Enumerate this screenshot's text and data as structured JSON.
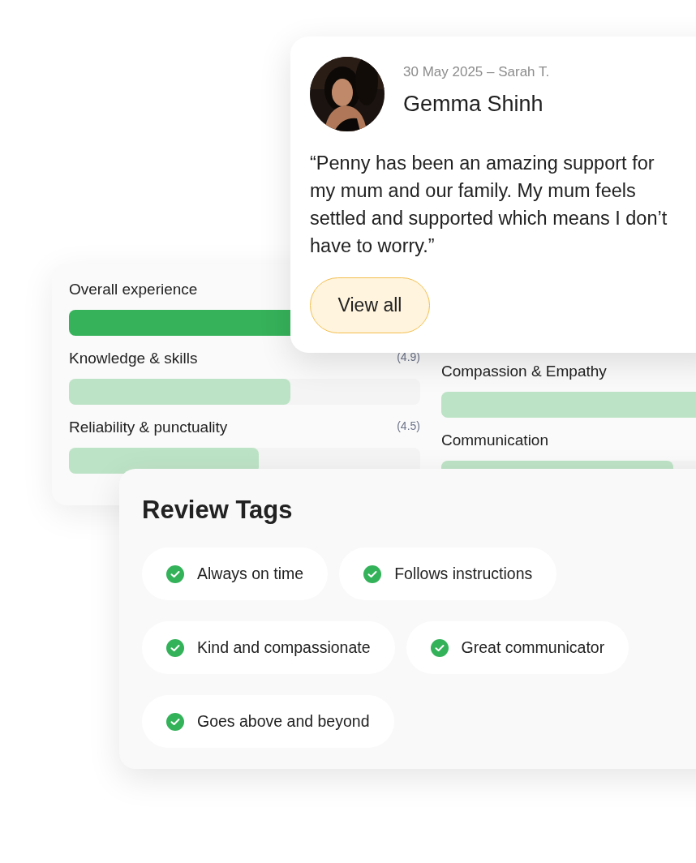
{
  "ratings": {
    "left": [
      {
        "label": "Overall experience",
        "primary": true,
        "level": 1.0
      },
      {
        "label": "Knowledge & skills",
        "score": "(4.9)",
        "primary": false,
        "level": 0.63
      },
      {
        "label": "Reliability & punctuality",
        "score": "(4.5)",
        "primary": false,
        "level": 0.54
      }
    ],
    "right": [
      {
        "label": "Compassion & Empathy",
        "primary": false,
        "level": 0.9
      },
      {
        "label": "Communication",
        "primary": false,
        "level": 0.66
      }
    ]
  },
  "review": {
    "meta": "30 May 2025 – Sarah T.",
    "name": "Gemma Shinh",
    "quote": "“Penny has been an amazing support for my mum and our family. My mum feels settled and supported which means I don’t have to worry.”",
    "button": "View all"
  },
  "review_tags": {
    "title": "Review Tags",
    "tags": [
      "Always on time",
      "Follows instructions",
      "Kind and compassionate",
      "Great communicator",
      "Goes above and beyond"
    ]
  }
}
